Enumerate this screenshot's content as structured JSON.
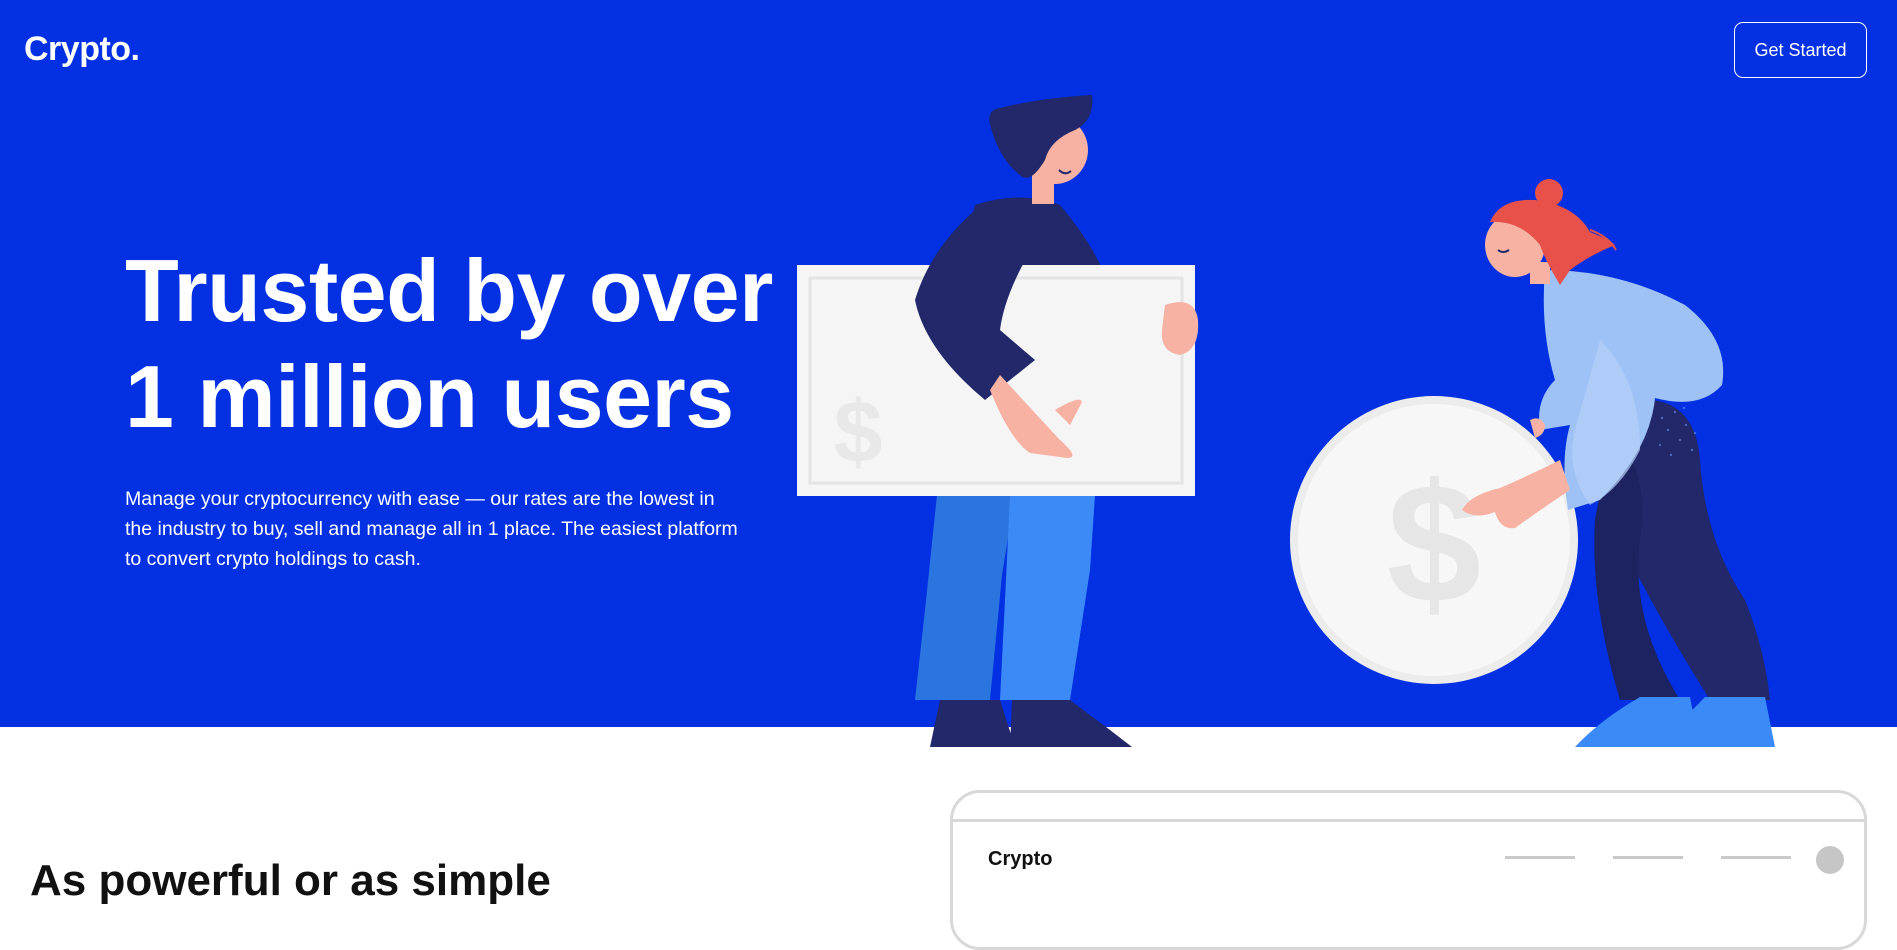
{
  "header": {
    "logo": "Crypto.",
    "cta_label": "Get Started"
  },
  "hero": {
    "headline_line1": "Trusted by over",
    "headline_line2": "1 million users",
    "description": "Manage your cryptocurrency with ease — our rates are the lowest in the industry to buy, sell and manage all in 1 place. The easiest platform to convert crypto holdings to cash."
  },
  "illustration": {
    "dollar_sign": "$"
  },
  "features": {
    "title": "As powerful or as simple"
  },
  "mockup": {
    "brand": "Crypto"
  },
  "colors": {
    "hero_background": "#0230e2",
    "navy": "#23286a",
    "accent_blue": "#3b8af8",
    "skin": "#f7b2a4",
    "hair_red": "#e8504a",
    "light_blue": "#9ec1f6"
  },
  "icons": [
    "dollar-sign-icon",
    "avatar-placeholder-icon"
  ]
}
